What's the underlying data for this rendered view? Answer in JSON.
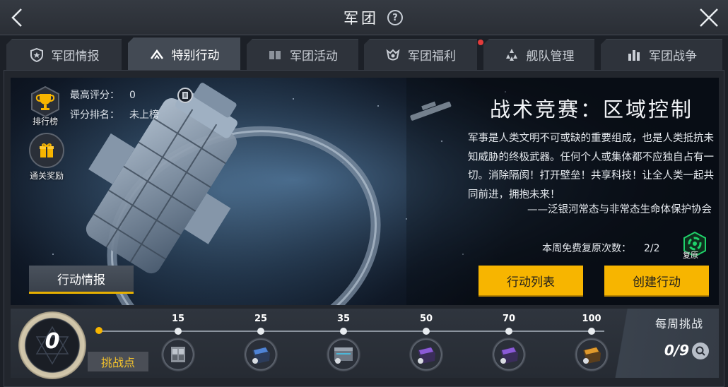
{
  "header": {
    "title": "军团",
    "help_symbol": "?"
  },
  "tabs": [
    {
      "label": "军团情报",
      "icon": "shield-star-icon",
      "active": false
    },
    {
      "label": "特别行动",
      "icon": "chevron-up-icon",
      "active": true
    },
    {
      "label": "军团活动",
      "icon": "book-icon",
      "active": false
    },
    {
      "label": "军团福利",
      "icon": "emblem-icon",
      "active": false,
      "notification": true
    },
    {
      "label": "舰队管理",
      "icon": "fleet-icon",
      "active": false
    },
    {
      "label": "军团战争",
      "icon": "buildings-icon",
      "active": false
    }
  ],
  "stats": {
    "best_score_label": "最高评分：",
    "best_score_value": "0",
    "rank_label": "评分排名：",
    "rank_value": "未上榜"
  },
  "side_buttons": {
    "leaderboard": "排行榜",
    "clear_reward": "通关奖励"
  },
  "event": {
    "title": "战术竞赛：区域控制",
    "description": "军事是人类文明不可或缺的重要组成，也是人类抵抗未知威胁的终极武器。任何个人或集体都不应独自占有一切。消除隔阂！打开壁垒！共享科技！让全人类一起共同前进，拥抱未来！",
    "signature": "——泛银河常态与非常态生命体保护协会",
    "revive_label": "本周免费复原次数：",
    "revive_value": "2/2",
    "revive_button": "复原"
  },
  "buttons": {
    "intel": "行动情报",
    "action_list": "行动列表",
    "create_action": "创建行动"
  },
  "progress": {
    "current_points": "0",
    "points_label": "挑战点",
    "milestones": [
      {
        "value": "15",
        "reward_icon": "ammo-crate-icon"
      },
      {
        "value": "25",
        "reward_icon": "blue-module-icon"
      },
      {
        "value": "35",
        "reward_icon": "chest-icon"
      },
      {
        "value": "50",
        "reward_icon": "purple-module-icon"
      },
      {
        "value": "70",
        "reward_icon": "purple-module-icon"
      },
      {
        "value": "100",
        "reward_icon": "gold-module-icon"
      }
    ],
    "weekly_label": "每周挑战",
    "weekly_value": "0/9"
  },
  "colors": {
    "accent": "#f7b500",
    "notification": "#e33b3b",
    "active_tab": "#434a54"
  }
}
